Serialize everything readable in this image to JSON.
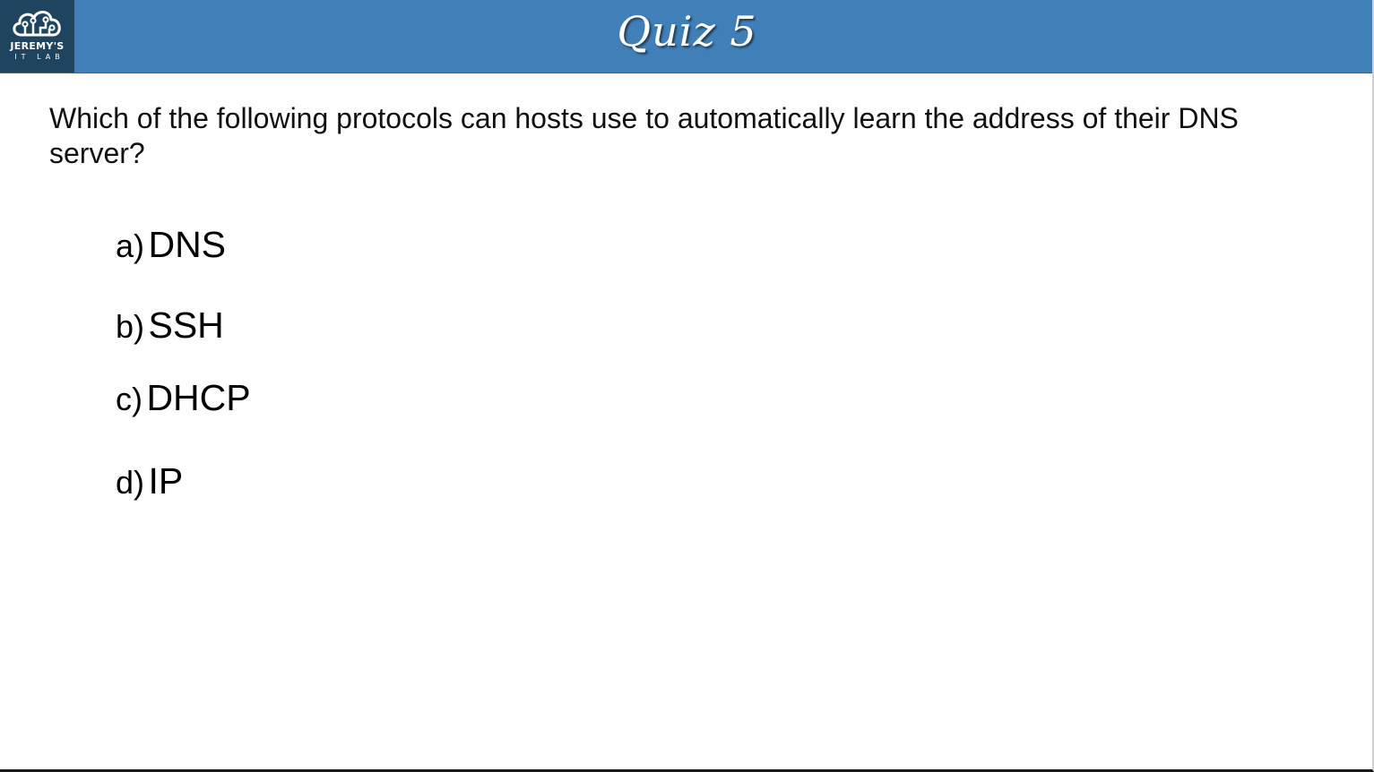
{
  "header": {
    "title": "Quiz 5",
    "background_color": "#417fb9",
    "logo": {
      "icon": "cloud-circuit-icon",
      "line1": "JEREMY'S",
      "line2": "IT LAB",
      "background_color": "#1f4460"
    }
  },
  "question": {
    "text": "Which of the following protocols can hosts use to automatically learn the address of their DNS server?"
  },
  "options": [
    {
      "letter": "a)",
      "text": "DNS"
    },
    {
      "letter": "b)",
      "text": "SSH"
    },
    {
      "letter": "c)",
      "text": "DHCP"
    },
    {
      "letter": "d)",
      "text": "IP"
    }
  ]
}
